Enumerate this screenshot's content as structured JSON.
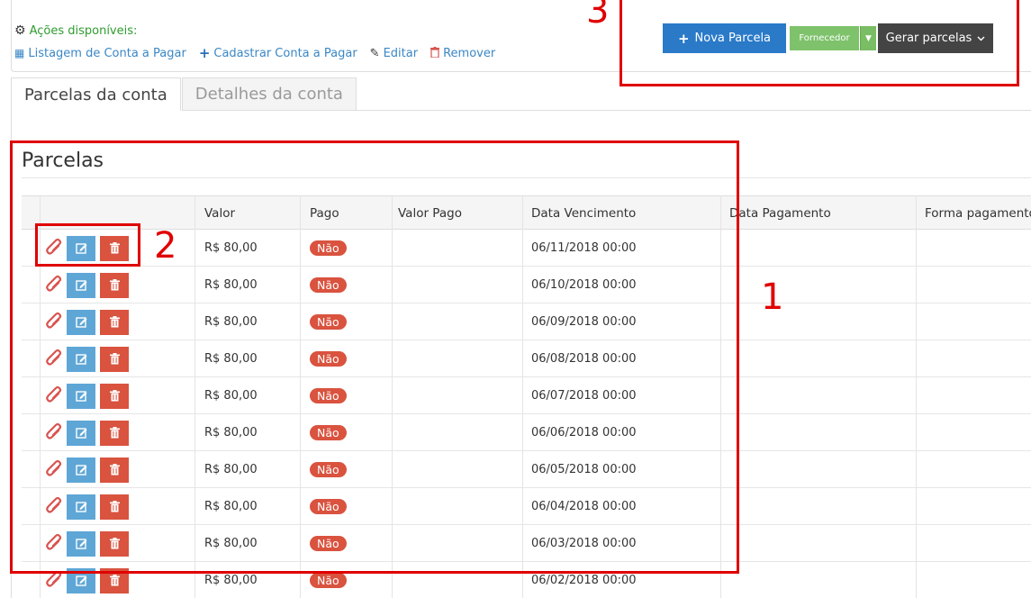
{
  "actions": {
    "title": "Ações disponíveis:",
    "links": [
      {
        "label": "Listagem de Conta a Pagar",
        "icon": "table-icon"
      },
      {
        "label": "Cadastrar Conta a Pagar",
        "icon": "plus-icon"
      },
      {
        "label": "Editar",
        "icon": "pencil-icon"
      },
      {
        "label": "Remover",
        "icon": "trash-icon"
      }
    ]
  },
  "buttons": {
    "nova_parcela": "Nova Parcela",
    "fornecedor": "Fornecedor",
    "gerar_parcelas": "Gerar parcelas"
  },
  "tabs": [
    "Parcelas da conta",
    "Detalhes da conta"
  ],
  "section_title": "Parcelas",
  "table": {
    "headers": [
      "Valor",
      "Pago",
      "Valor Pago",
      "Data Vencimento",
      "Data Pagamento",
      "Forma pagamento"
    ],
    "rows": [
      {
        "valor": "R$ 80,00",
        "pago": "Não",
        "valor_pago": "",
        "vencimento": "06/11/2018 00:00",
        "pagamento": "",
        "forma": ""
      },
      {
        "valor": "R$ 80,00",
        "pago": "Não",
        "valor_pago": "",
        "vencimento": "06/10/2018 00:00",
        "pagamento": "",
        "forma": ""
      },
      {
        "valor": "R$ 80,00",
        "pago": "Não",
        "valor_pago": "",
        "vencimento": "06/09/2018 00:00",
        "pagamento": "",
        "forma": ""
      },
      {
        "valor": "R$ 80,00",
        "pago": "Não",
        "valor_pago": "",
        "vencimento": "06/08/2018 00:00",
        "pagamento": "",
        "forma": ""
      },
      {
        "valor": "R$ 80,00",
        "pago": "Não",
        "valor_pago": "",
        "vencimento": "06/07/2018 00:00",
        "pagamento": "",
        "forma": ""
      },
      {
        "valor": "R$ 80,00",
        "pago": "Não",
        "valor_pago": "",
        "vencimento": "06/06/2018 00:00",
        "pagamento": "",
        "forma": ""
      },
      {
        "valor": "R$ 80,00",
        "pago": "Não",
        "valor_pago": "",
        "vencimento": "06/05/2018 00:00",
        "pagamento": "",
        "forma": ""
      },
      {
        "valor": "R$ 80,00",
        "pago": "Não",
        "valor_pago": "",
        "vencimento": "06/04/2018 00:00",
        "pagamento": "",
        "forma": ""
      },
      {
        "valor": "R$ 80,00",
        "pago": "Não",
        "valor_pago": "",
        "vencimento": "06/03/2018 00:00",
        "pagamento": "",
        "forma": ""
      },
      {
        "valor": "R$ 80,00",
        "pago": "Não",
        "valor_pago": "",
        "vencimento": "06/02/2018 00:00",
        "pagamento": "",
        "forma": ""
      }
    ]
  },
  "annotations": [
    "1",
    "2",
    "3"
  ],
  "colors": {
    "primary": "#2a7ac8",
    "success": "#7ec26b",
    "dark": "#444444",
    "danger": "#d9533f",
    "info": "#5ea6d6",
    "annotation": "#e00000",
    "actions_title": "#2e9d2e",
    "link": "#3a87c6"
  }
}
